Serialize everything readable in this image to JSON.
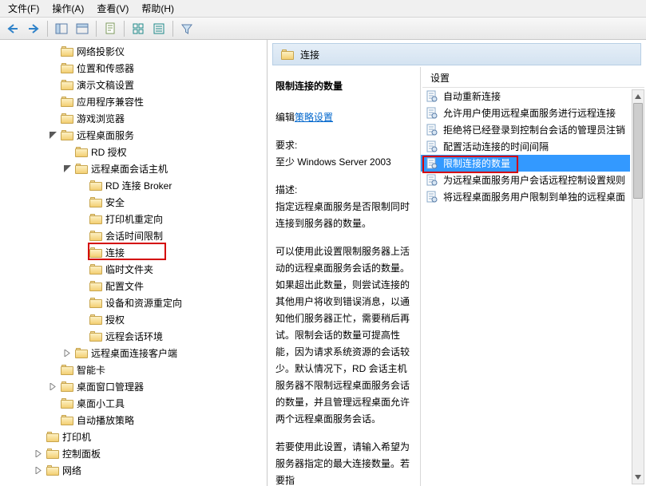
{
  "menu": {
    "file": "文件(F)",
    "action": "操作(A)",
    "view": "查看(V)",
    "help": "帮助(H)"
  },
  "detail": {
    "header_label": "连接",
    "title": "限制连接的数量",
    "edit_prefix": "编辑",
    "edit_link": "策略设置",
    "req_label": "要求:",
    "req_value": "至少 Windows Server 2003",
    "desc_label": "描述:",
    "desc_p1": "指定远程桌面服务是否限制同时连接到服务器的数量。",
    "desc_p2": "可以使用此设置限制服务器上活动的远程桌面服务会话的数量。如果超出此数量，则尝试连接的其他用户将收到错误消息，以通知他们服务器正忙，需要稍后再试。限制会话的数量可提高性能，因为请求系统资源的会话较少。默认情况下，RD 会话主机服务器不限制远程桌面服务会话的数量，并且管理远程桌面允许两个远程桌面服务会话。",
    "desc_p3": "若要使用此设置，请输入希望为服务器指定的最大连接数量。若要指"
  },
  "settings_header": "设置",
  "settings_items": [
    "自动重新连接",
    "允许用户使用远程桌面服务进行远程连接",
    "拒绝将已经登录到控制台会话的管理员注销",
    "配置活动连接的时间间隔",
    "限制连接的数量",
    "为远程桌面服务用户会话远程控制设置规则",
    "将远程桌面服务用户限制到单独的远程桌面"
  ],
  "settings_selected_index": 4,
  "tree": [
    {
      "label": "网络投影仪",
      "depth": 3
    },
    {
      "label": "位置和传感器",
      "depth": 3
    },
    {
      "label": "演示文稿设置",
      "depth": 3
    },
    {
      "label": "应用程序兼容性",
      "depth": 3
    },
    {
      "label": "游戏浏览器",
      "depth": 3
    },
    {
      "label": "远程桌面服务",
      "depth": 3,
      "expanded": true
    },
    {
      "label": "RD 授权",
      "depth": 4
    },
    {
      "label": "远程桌面会话主机",
      "depth": 4,
      "expanded": true
    },
    {
      "label": "RD 连接 Broker",
      "depth": 5
    },
    {
      "label": "安全",
      "depth": 5
    },
    {
      "label": "打印机重定向",
      "depth": 5
    },
    {
      "label": "会话时间限制",
      "depth": 5
    },
    {
      "label": "连接",
      "depth": 5,
      "highlight": true
    },
    {
      "label": "临时文件夹",
      "depth": 5
    },
    {
      "label": "配置文件",
      "depth": 5
    },
    {
      "label": "设备和资源重定向",
      "depth": 5
    },
    {
      "label": "授权",
      "depth": 5
    },
    {
      "label": "远程会话环境",
      "depth": 5
    },
    {
      "label": "远程桌面连接客户端",
      "depth": 4,
      "collapsed": true
    },
    {
      "label": "智能卡",
      "depth": 3
    },
    {
      "label": "桌面窗口管理器",
      "depth": 3,
      "collapsed": true
    },
    {
      "label": "桌面小工具",
      "depth": 3
    },
    {
      "label": "自动播放策略",
      "depth": 3
    },
    {
      "label": "打印机",
      "depth": 2
    },
    {
      "label": "控制面板",
      "depth": 2,
      "collapsed": true
    },
    {
      "label": "网络",
      "depth": 2,
      "collapsed": true
    }
  ]
}
